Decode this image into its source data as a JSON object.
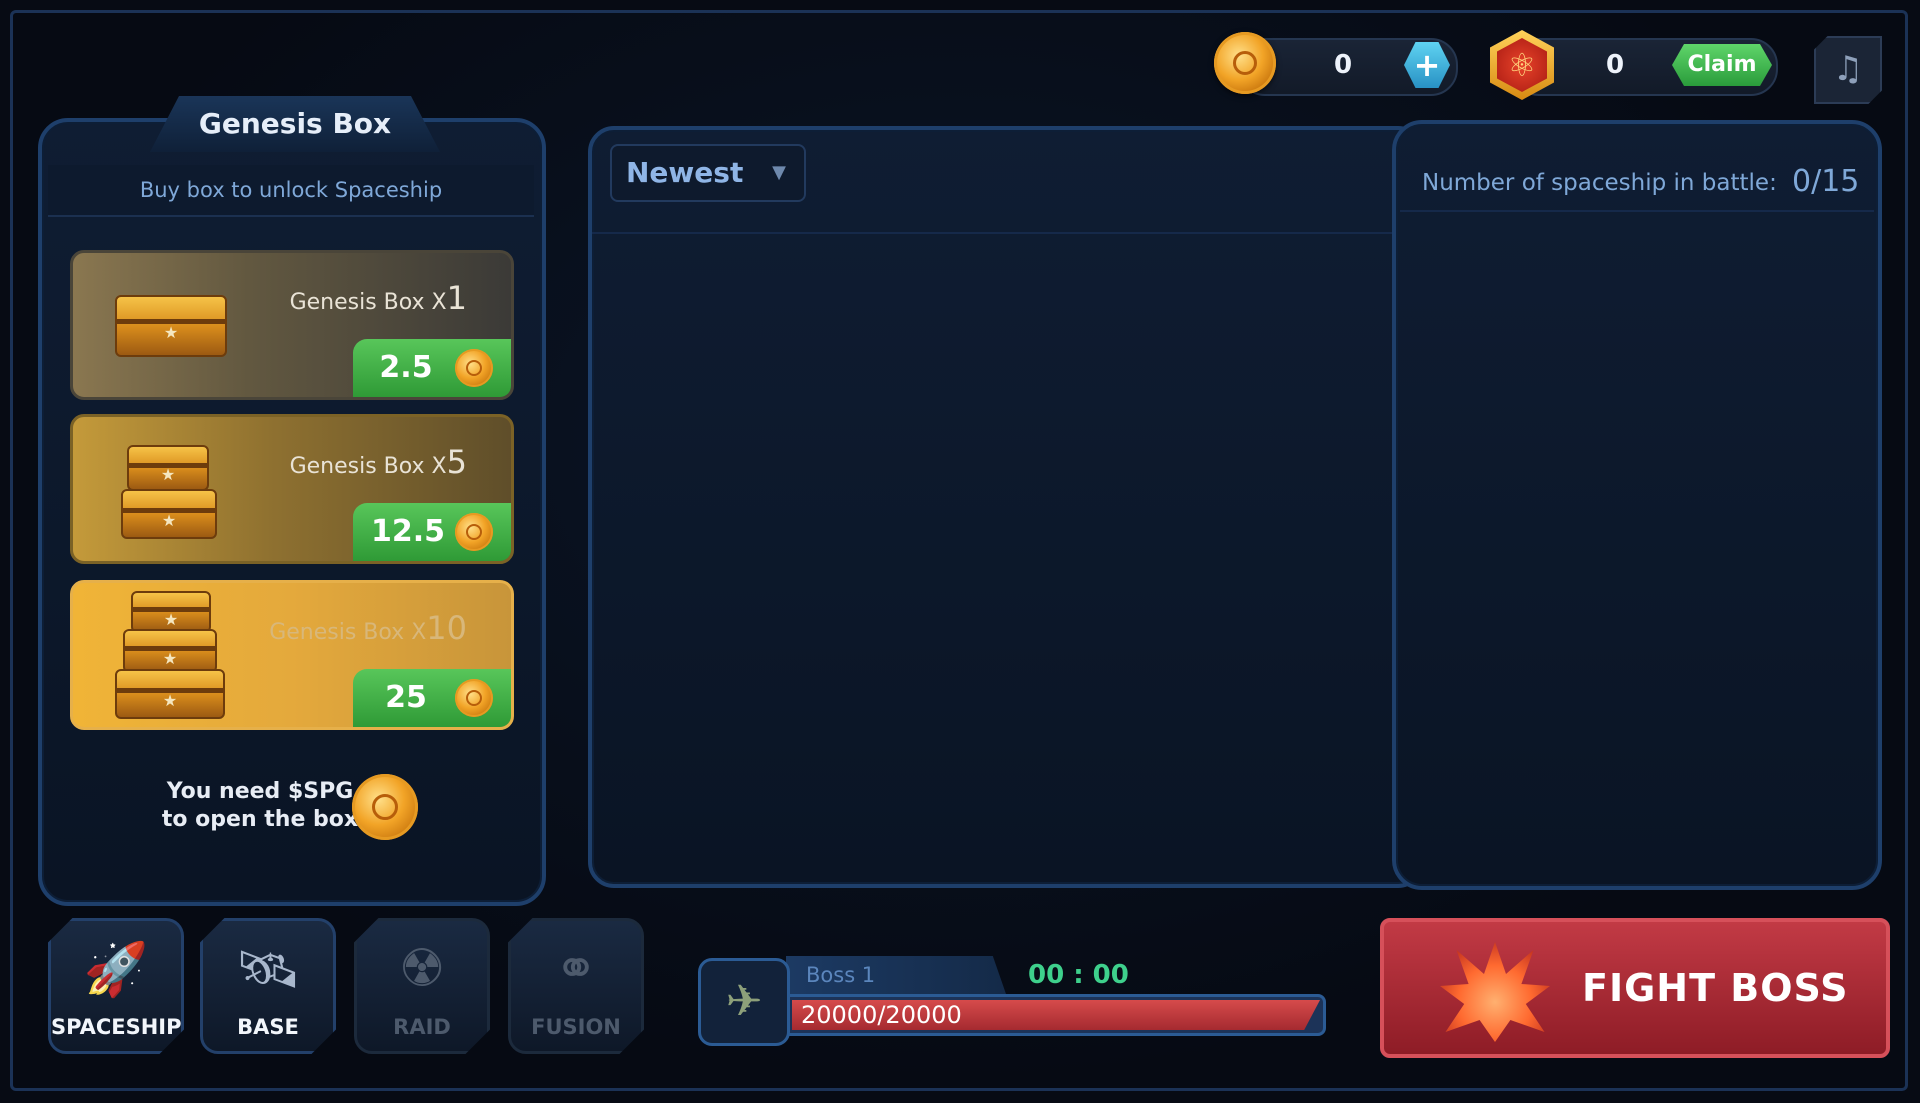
{
  "topbar": {
    "coin_balance": "0",
    "add_label": "+",
    "atom_balance": "0",
    "claim_label": "Claim",
    "music_icon": "♫"
  },
  "shop": {
    "title": "Genesis Box",
    "subtitle": "Buy box to unlock Spaceship",
    "boxes": [
      {
        "label": "Genesis Box X",
        "multiplier": "1",
        "price": "2.5"
      },
      {
        "label": "Genesis Box X",
        "multiplier": "5",
        "price": "12.5"
      },
      {
        "label": "Genesis Box X",
        "multiplier": "10",
        "price": "25"
      }
    ],
    "requirement_line1": "You need $SPG",
    "requirement_line2": "to open the box"
  },
  "inventory": {
    "sort_selected": "Newest",
    "sort_arrow": "▼"
  },
  "battle": {
    "label": "Number of spaceship in battle:",
    "count": "0/15"
  },
  "nav": [
    {
      "label": "SPACESHIP",
      "icon": "rocket-icon",
      "glyph": "🚀",
      "enabled": true
    },
    {
      "label": "BASE",
      "icon": "satellite-icon",
      "glyph": "🛰",
      "enabled": true
    },
    {
      "label": "RAID",
      "icon": "radiation-icon",
      "glyph": "☢",
      "enabled": false
    },
    {
      "label": "FUSION",
      "icon": "fusion-icon",
      "glyph": "⚭",
      "enabled": false
    }
  ],
  "boss": {
    "name": "Boss 1",
    "timer": "00 : 00",
    "hp_text": "20000/20000",
    "hp_fraction": 1.0,
    "avatar_glyph": "✈"
  },
  "fight": {
    "label": "FIGHT BOSS"
  },
  "colors": {
    "accent_green": "#3ed08c",
    "hp_red": "#d64b4b",
    "panel_border": "#1e3f6b"
  }
}
